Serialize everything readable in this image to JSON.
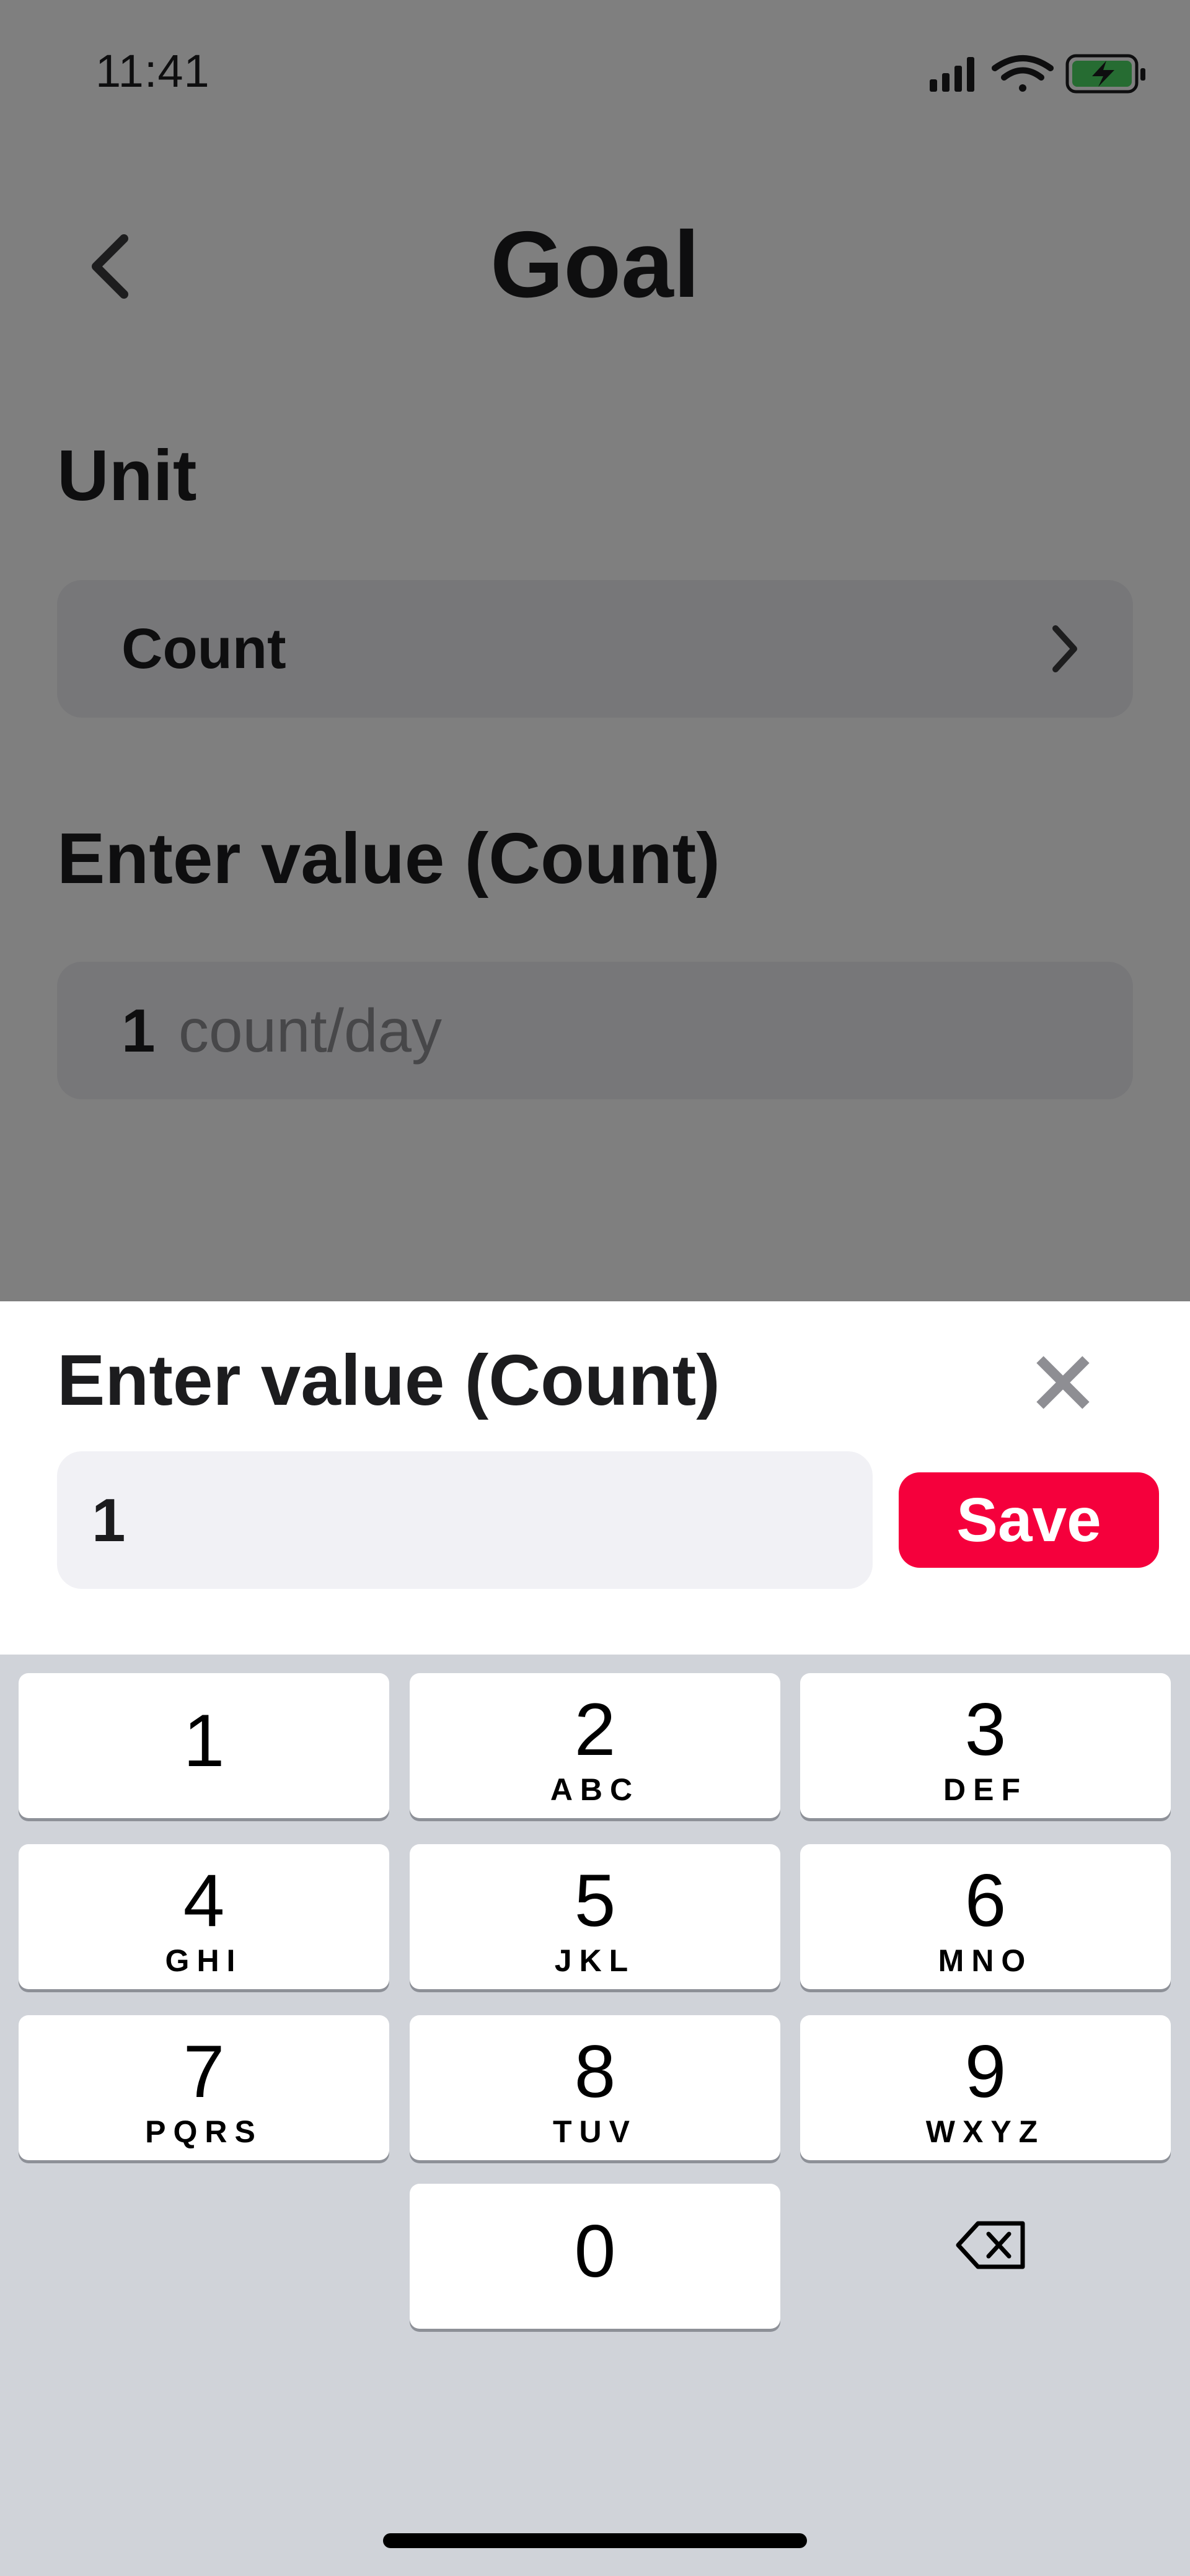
{
  "status_bar": {
    "time": "11:41",
    "icons": [
      "cellular-signal-icon",
      "wifi-icon",
      "battery-charging-icon"
    ]
  },
  "header": {
    "title": "Goal",
    "back_icon": "chevron-left-icon"
  },
  "unit_section": {
    "label": "Unit",
    "value": "Count",
    "chevron_icon": "chevron-right-icon"
  },
  "value_section": {
    "label": "Enter value (Count)",
    "value": "1",
    "unit_suffix": "count/day"
  },
  "sheet": {
    "title": "Enter value (Count)",
    "input_value": "1",
    "save_label": "Save",
    "close_icon": "close-icon"
  },
  "keypad": {
    "keys": [
      {
        "digit": "1",
        "letters": ""
      },
      {
        "digit": "2",
        "letters": "ABC"
      },
      {
        "digit": "3",
        "letters": "DEF"
      },
      {
        "digit": "4",
        "letters": "GHI"
      },
      {
        "digit": "5",
        "letters": "JKL"
      },
      {
        "digit": "6",
        "letters": "MNO"
      },
      {
        "digit": "7",
        "letters": "PQRS"
      },
      {
        "digit": "8",
        "letters": "TUV"
      },
      {
        "digit": "9",
        "letters": "WXYZ"
      },
      {
        "digit": "0",
        "letters": ""
      }
    ],
    "delete_icon": "backspace-icon"
  },
  "colors": {
    "accent": "#f5003c",
    "field_bg": "#eeeef3",
    "keyboard_bg": "#d0d3d9",
    "overlay": "rgba(0,0,0,0.5)"
  }
}
